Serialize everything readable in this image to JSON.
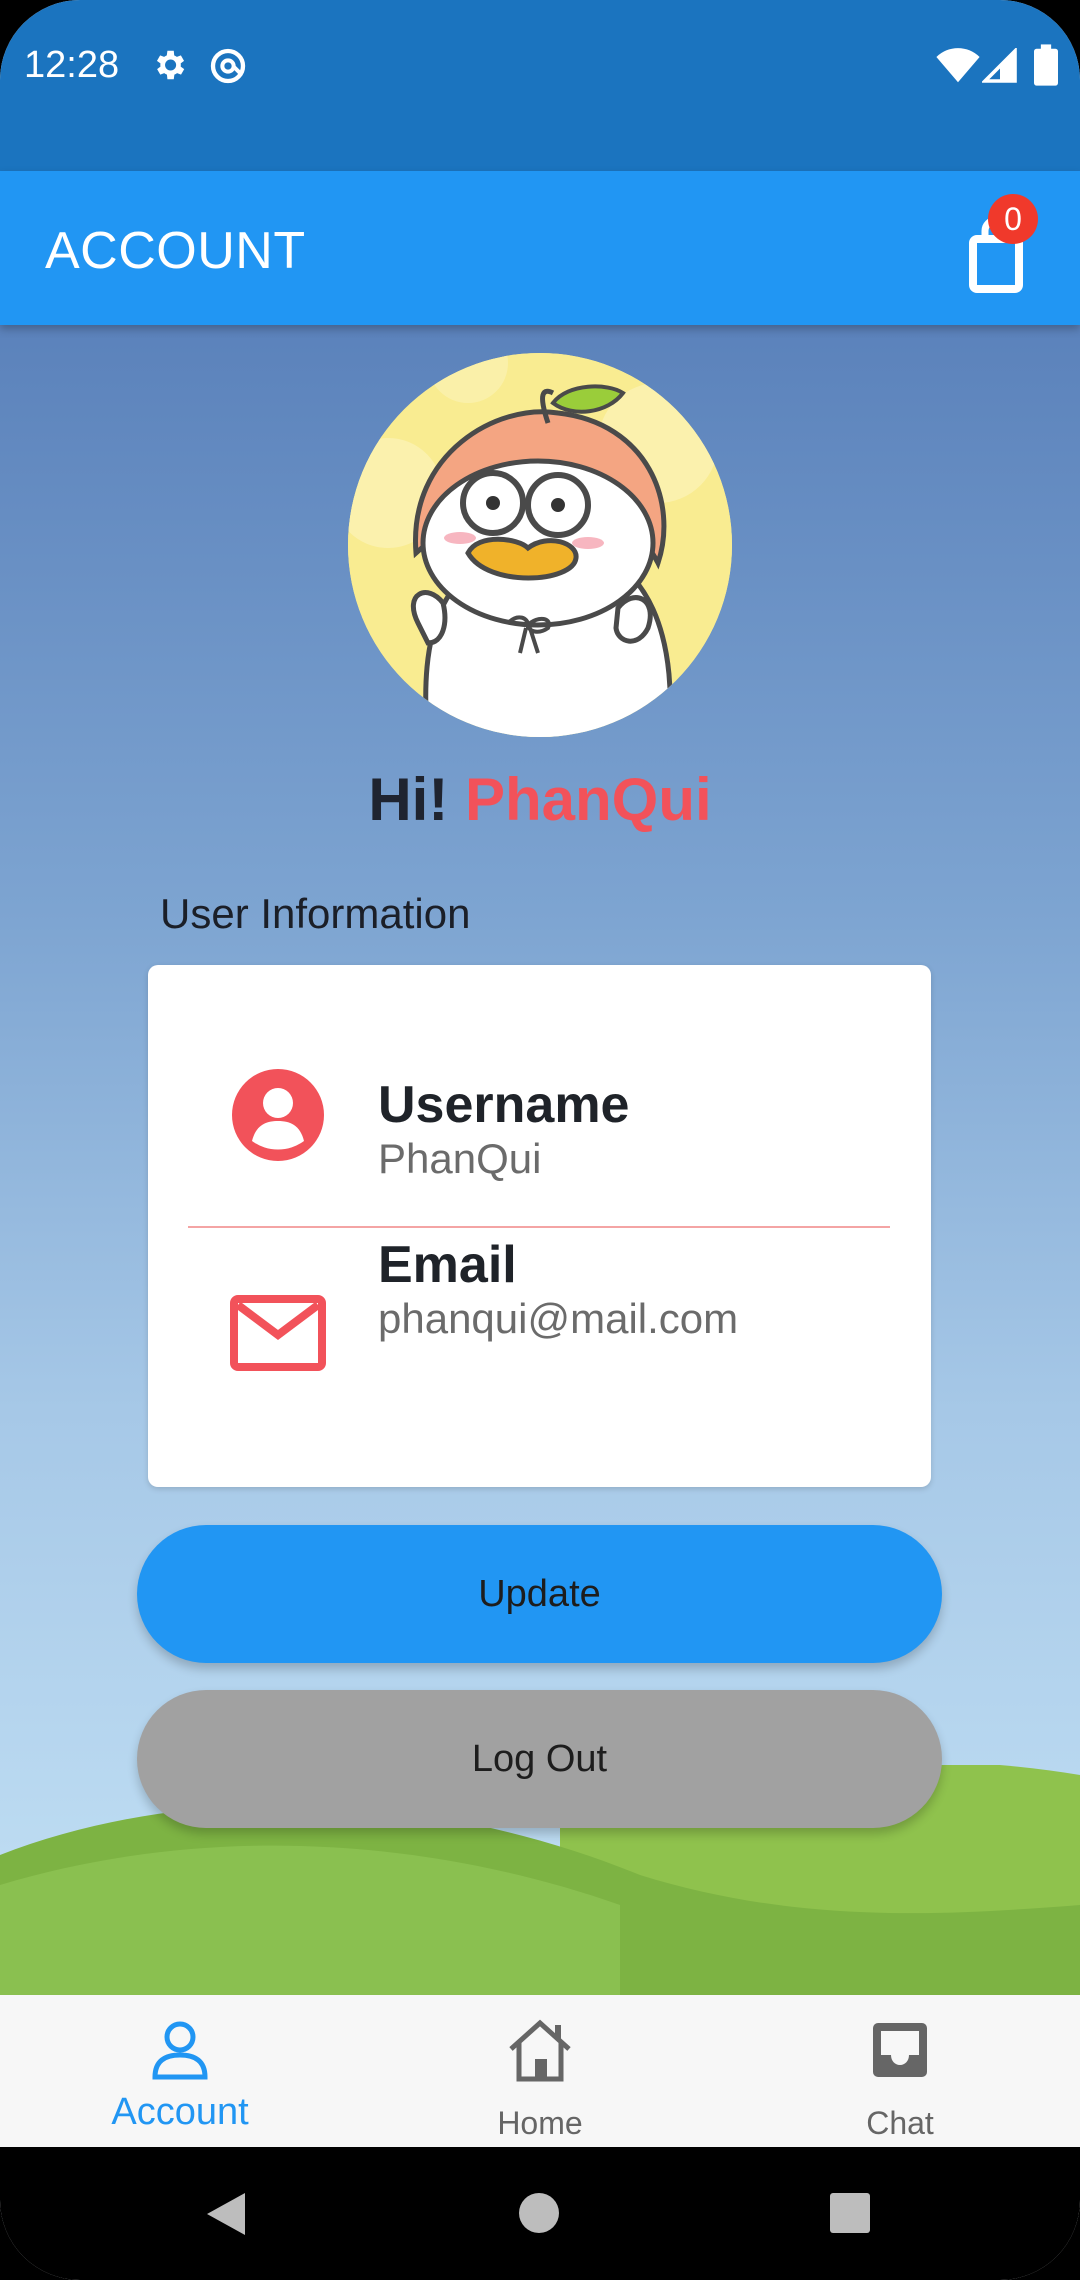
{
  "status_bar": {
    "time": "12:28",
    "icons": [
      "settings-icon",
      "at-sign-icon",
      "wifi-icon",
      "signal-icon",
      "battery-icon"
    ]
  },
  "app_bar": {
    "title": "ACCOUNT",
    "cart_count": "0",
    "cart_icon": "shopping-bag-icon"
  },
  "profile": {
    "greeting_prefix": "Hi!",
    "name": "PhanQui"
  },
  "user_info": {
    "section_label": "User Information",
    "rows": [
      {
        "label": "Username",
        "value": "PhanQui",
        "icon": "person-icon"
      },
      {
        "label": "Email",
        "value": "phanqui@mail.com",
        "icon": "mail-icon"
      }
    ]
  },
  "actions": {
    "update_label": "Update",
    "logout_label": "Log Out"
  },
  "bottom_nav": {
    "items": [
      {
        "label": "Account",
        "icon": "person-outline-icon",
        "active": true
      },
      {
        "label": "Home",
        "icon": "home-icon",
        "active": false
      },
      {
        "label": "Chat",
        "icon": "inbox-icon",
        "active": false
      }
    ]
  },
  "colors": {
    "status_bar": "#1b74bf",
    "app_bar": "#2196f3",
    "accent_red": "#f2525a",
    "active_nav": "#2196f3",
    "inactive_nav": "#666666",
    "logout_button": "#a1a1a1"
  }
}
